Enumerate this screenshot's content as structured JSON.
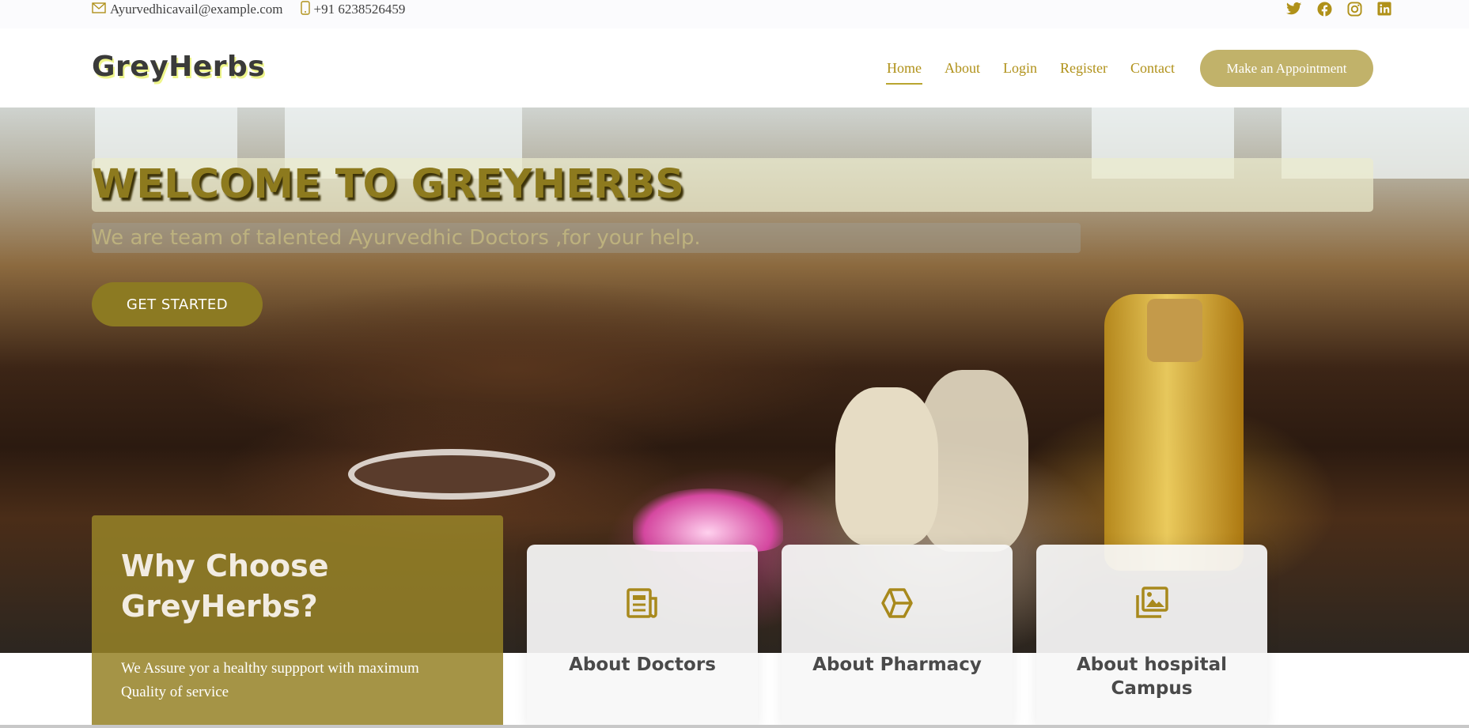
{
  "topbar": {
    "email": "Ayurvedhicavail@example.com",
    "phone": "+91 6238526459",
    "icons": {
      "email": "envelope-icon",
      "phone": "phone-icon"
    },
    "social": [
      "twitter-icon",
      "facebook-icon",
      "instagram-icon",
      "linkedin-icon"
    ]
  },
  "header": {
    "logo": "GreyHerbs",
    "nav": [
      "Home",
      "About",
      "Login",
      "Register",
      "Contact"
    ],
    "active_nav": "Home",
    "cta": "Make an Appointment"
  },
  "hero": {
    "title": "WELCOME TO GREYHERBS",
    "subtitle": "We are team of talented Ayurvedhic Doctors ,for your help.",
    "button": "GET STARTED"
  },
  "why": {
    "heading": "Why Choose GreyHerbs?",
    "text": "We Assure yor a healthy suppport with maximum Quality of service"
  },
  "cards": [
    {
      "title": "About Doctors",
      "icon": "newspaper-icon"
    },
    {
      "title": "About Pharmacy",
      "icon": "cube-icon"
    },
    {
      "title": "About hospital Campus",
      "icon": "images-icon"
    }
  ],
  "colors": {
    "accent": "#b09119",
    "button": "#c1b26a",
    "hero_button": "#8c7a22",
    "why_bg": "#968228",
    "icon": "#a8891c"
  }
}
